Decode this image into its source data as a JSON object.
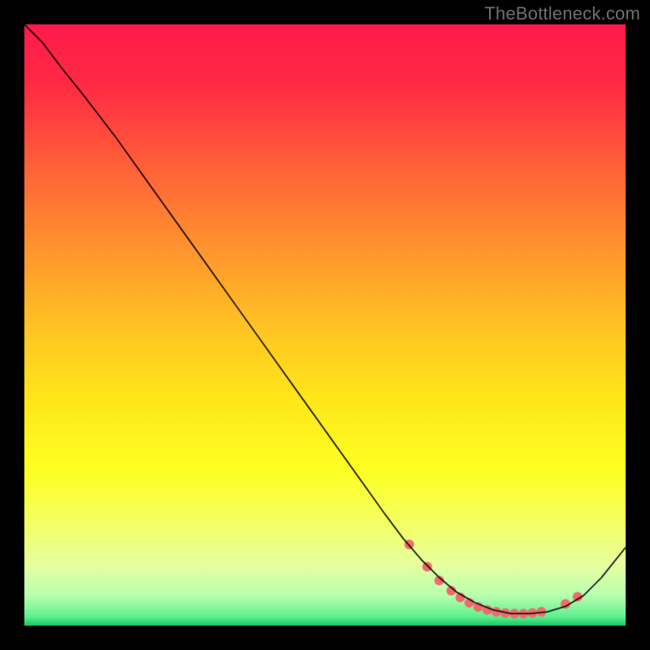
{
  "watermark": "TheBottleneck.com",
  "chart_data": {
    "type": "line",
    "title": "",
    "xlabel": "",
    "ylabel": "",
    "xlim": [
      0,
      100
    ],
    "ylim": [
      0,
      100
    ],
    "background_gradient": {
      "comment": "vertical gradient from red at top through orange, yellow, pale-yellow, light-green to green at bottom",
      "stops": [
        {
          "pos": 0.0,
          "color": "#ff1a4b"
        },
        {
          "pos": 0.1,
          "color": "#ff2a44"
        },
        {
          "pos": 0.22,
          "color": "#ff5a3a"
        },
        {
          "pos": 0.35,
          "color": "#ff8c30"
        },
        {
          "pos": 0.5,
          "color": "#ffc224"
        },
        {
          "pos": 0.62,
          "color": "#ffe61a"
        },
        {
          "pos": 0.74,
          "color": "#feff22"
        },
        {
          "pos": 0.83,
          "color": "#f4ff63"
        },
        {
          "pos": 0.9,
          "color": "#e6ffa0"
        },
        {
          "pos": 0.95,
          "color": "#b8ffb0"
        },
        {
          "pos": 0.985,
          "color": "#60f090"
        },
        {
          "pos": 1.0,
          "color": "#18c864"
        }
      ]
    },
    "series": [
      {
        "name": "curve",
        "comment": "black thin curve; y is plotted with 0 at bottom. Values are percent of plot area.",
        "x": [
          0,
          3,
          6,
          10,
          15,
          20,
          25,
          30,
          35,
          40,
          45,
          50,
          55,
          60,
          63,
          66,
          69,
          72,
          75,
          78,
          81,
          84,
          87,
          90,
          93,
          96,
          100
        ],
        "y": [
          100,
          97,
          93,
          88,
          81.5,
          74.5,
          67.5,
          60.5,
          53.5,
          46.5,
          39.5,
          32.5,
          25.5,
          18.5,
          14.5,
          11,
          8,
          5.5,
          3.8,
          2.6,
          2.0,
          2.0,
          2.3,
          3.2,
          5.0,
          8.0,
          13
        ],
        "stroke": "#000000",
        "width": 1.6
      }
    ],
    "markers": {
      "comment": "salmon circular markers along the valley of the curve",
      "color": "#f06a6a",
      "radius": 6,
      "points": [
        {
          "x": 64,
          "y": 13.5
        },
        {
          "x": 67,
          "y": 9.8
        },
        {
          "x": 69,
          "y": 7.5
        },
        {
          "x": 71,
          "y": 5.8
        },
        {
          "x": 72.5,
          "y": 4.7
        },
        {
          "x": 74,
          "y": 3.8
        },
        {
          "x": 75.5,
          "y": 3.1
        },
        {
          "x": 77,
          "y": 2.6
        },
        {
          "x": 78.5,
          "y": 2.3
        },
        {
          "x": 80,
          "y": 2.1
        },
        {
          "x": 81.5,
          "y": 2.0
        },
        {
          "x": 83,
          "y": 2.0
        },
        {
          "x": 84.5,
          "y": 2.1
        },
        {
          "x": 86,
          "y": 2.3
        },
        {
          "x": 90,
          "y": 3.6
        },
        {
          "x": 92,
          "y": 4.8
        }
      ]
    }
  }
}
